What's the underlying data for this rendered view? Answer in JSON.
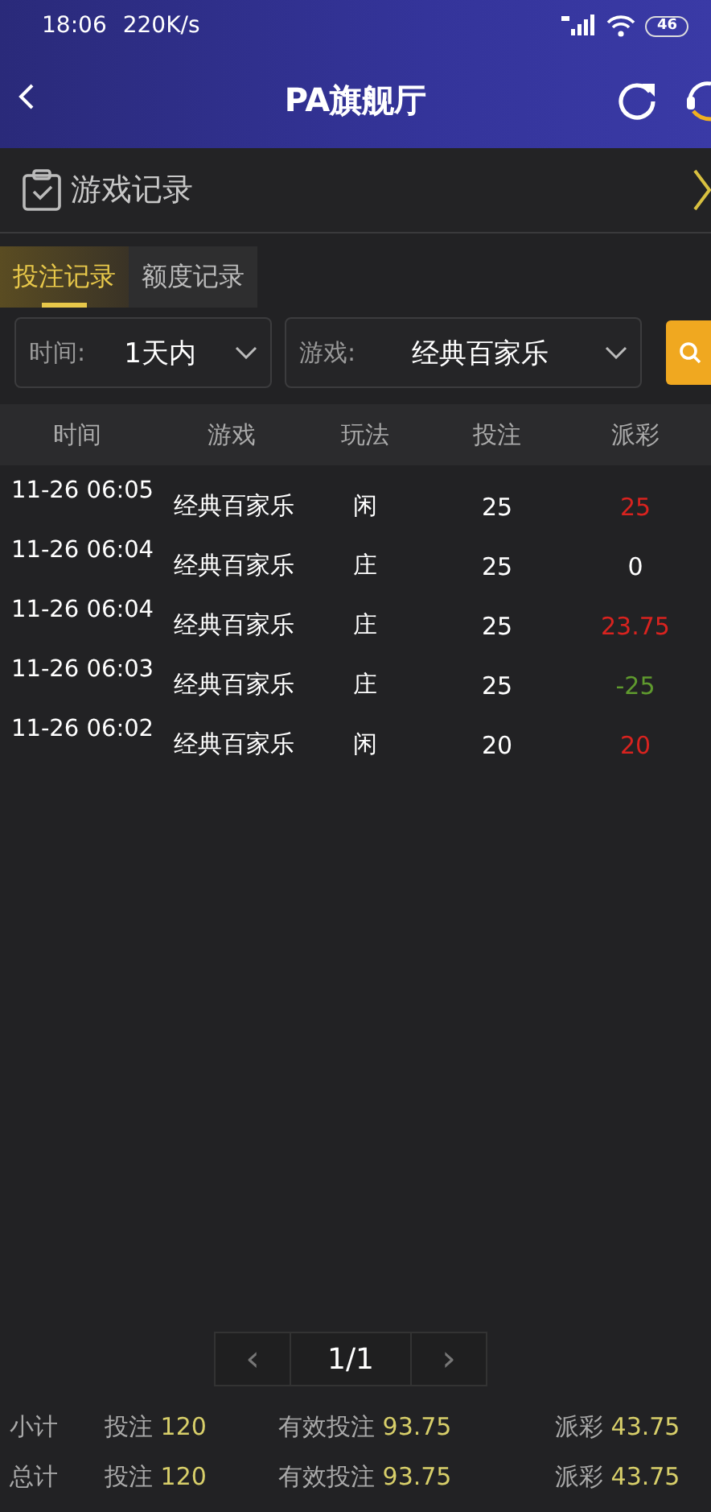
{
  "status_bar": {
    "time": "18:06",
    "speed": "220K/s",
    "battery": "46"
  },
  "header": {
    "title": "PA旗舰厅"
  },
  "section": {
    "title": "游戏记录"
  },
  "tabs": [
    {
      "label": "投注记录",
      "selected": true
    },
    {
      "label": "额度记录",
      "selected": false
    }
  ],
  "filters": [
    {
      "label": "时间:",
      "value": "1天内"
    },
    {
      "label": "游戏:",
      "value": "经典百家乐"
    }
  ],
  "table": {
    "columns": [
      "时间",
      "游戏",
      "玩法",
      "投注",
      "派彩"
    ],
    "rows": [
      {
        "time": "11-26 06:05",
        "game": "经典百家乐",
        "play": "闲",
        "bet": "25",
        "payout": "25",
        "color": "#d8231f"
      },
      {
        "time": "11-26 06:04",
        "game": "经典百家乐",
        "play": "庄",
        "bet": "25",
        "payout": "0",
        "color": "#ffffff"
      },
      {
        "time": "11-26 06:04",
        "game": "经典百家乐",
        "play": "庄",
        "bet": "25",
        "payout": "23.75",
        "color": "#d8231f"
      },
      {
        "time": "11-26 06:03",
        "game": "经典百家乐",
        "play": "庄",
        "bet": "25",
        "payout": "-25",
        "color": "#5f9a2e"
      },
      {
        "time": "11-26 06:02",
        "game": "经典百家乐",
        "play": "闲",
        "bet": "20",
        "payout": "20",
        "color": "#d8231f"
      }
    ]
  },
  "pagination": {
    "prev": "‹",
    "page": "1/1",
    "next": "›"
  },
  "totals": [
    {
      "label": "小计",
      "items": [
        {
          "label": "投注",
          "value": "120"
        },
        {
          "label": "有效投注",
          "value": "93.75"
        },
        {
          "label": "派彩",
          "value": "43.75"
        }
      ]
    },
    {
      "label": "总计",
      "items": [
        {
          "label": "投注",
          "value": "120"
        },
        {
          "label": "有效投注",
          "value": "93.75"
        },
        {
          "label": "派彩",
          "value": "43.75"
        }
      ]
    }
  ]
}
